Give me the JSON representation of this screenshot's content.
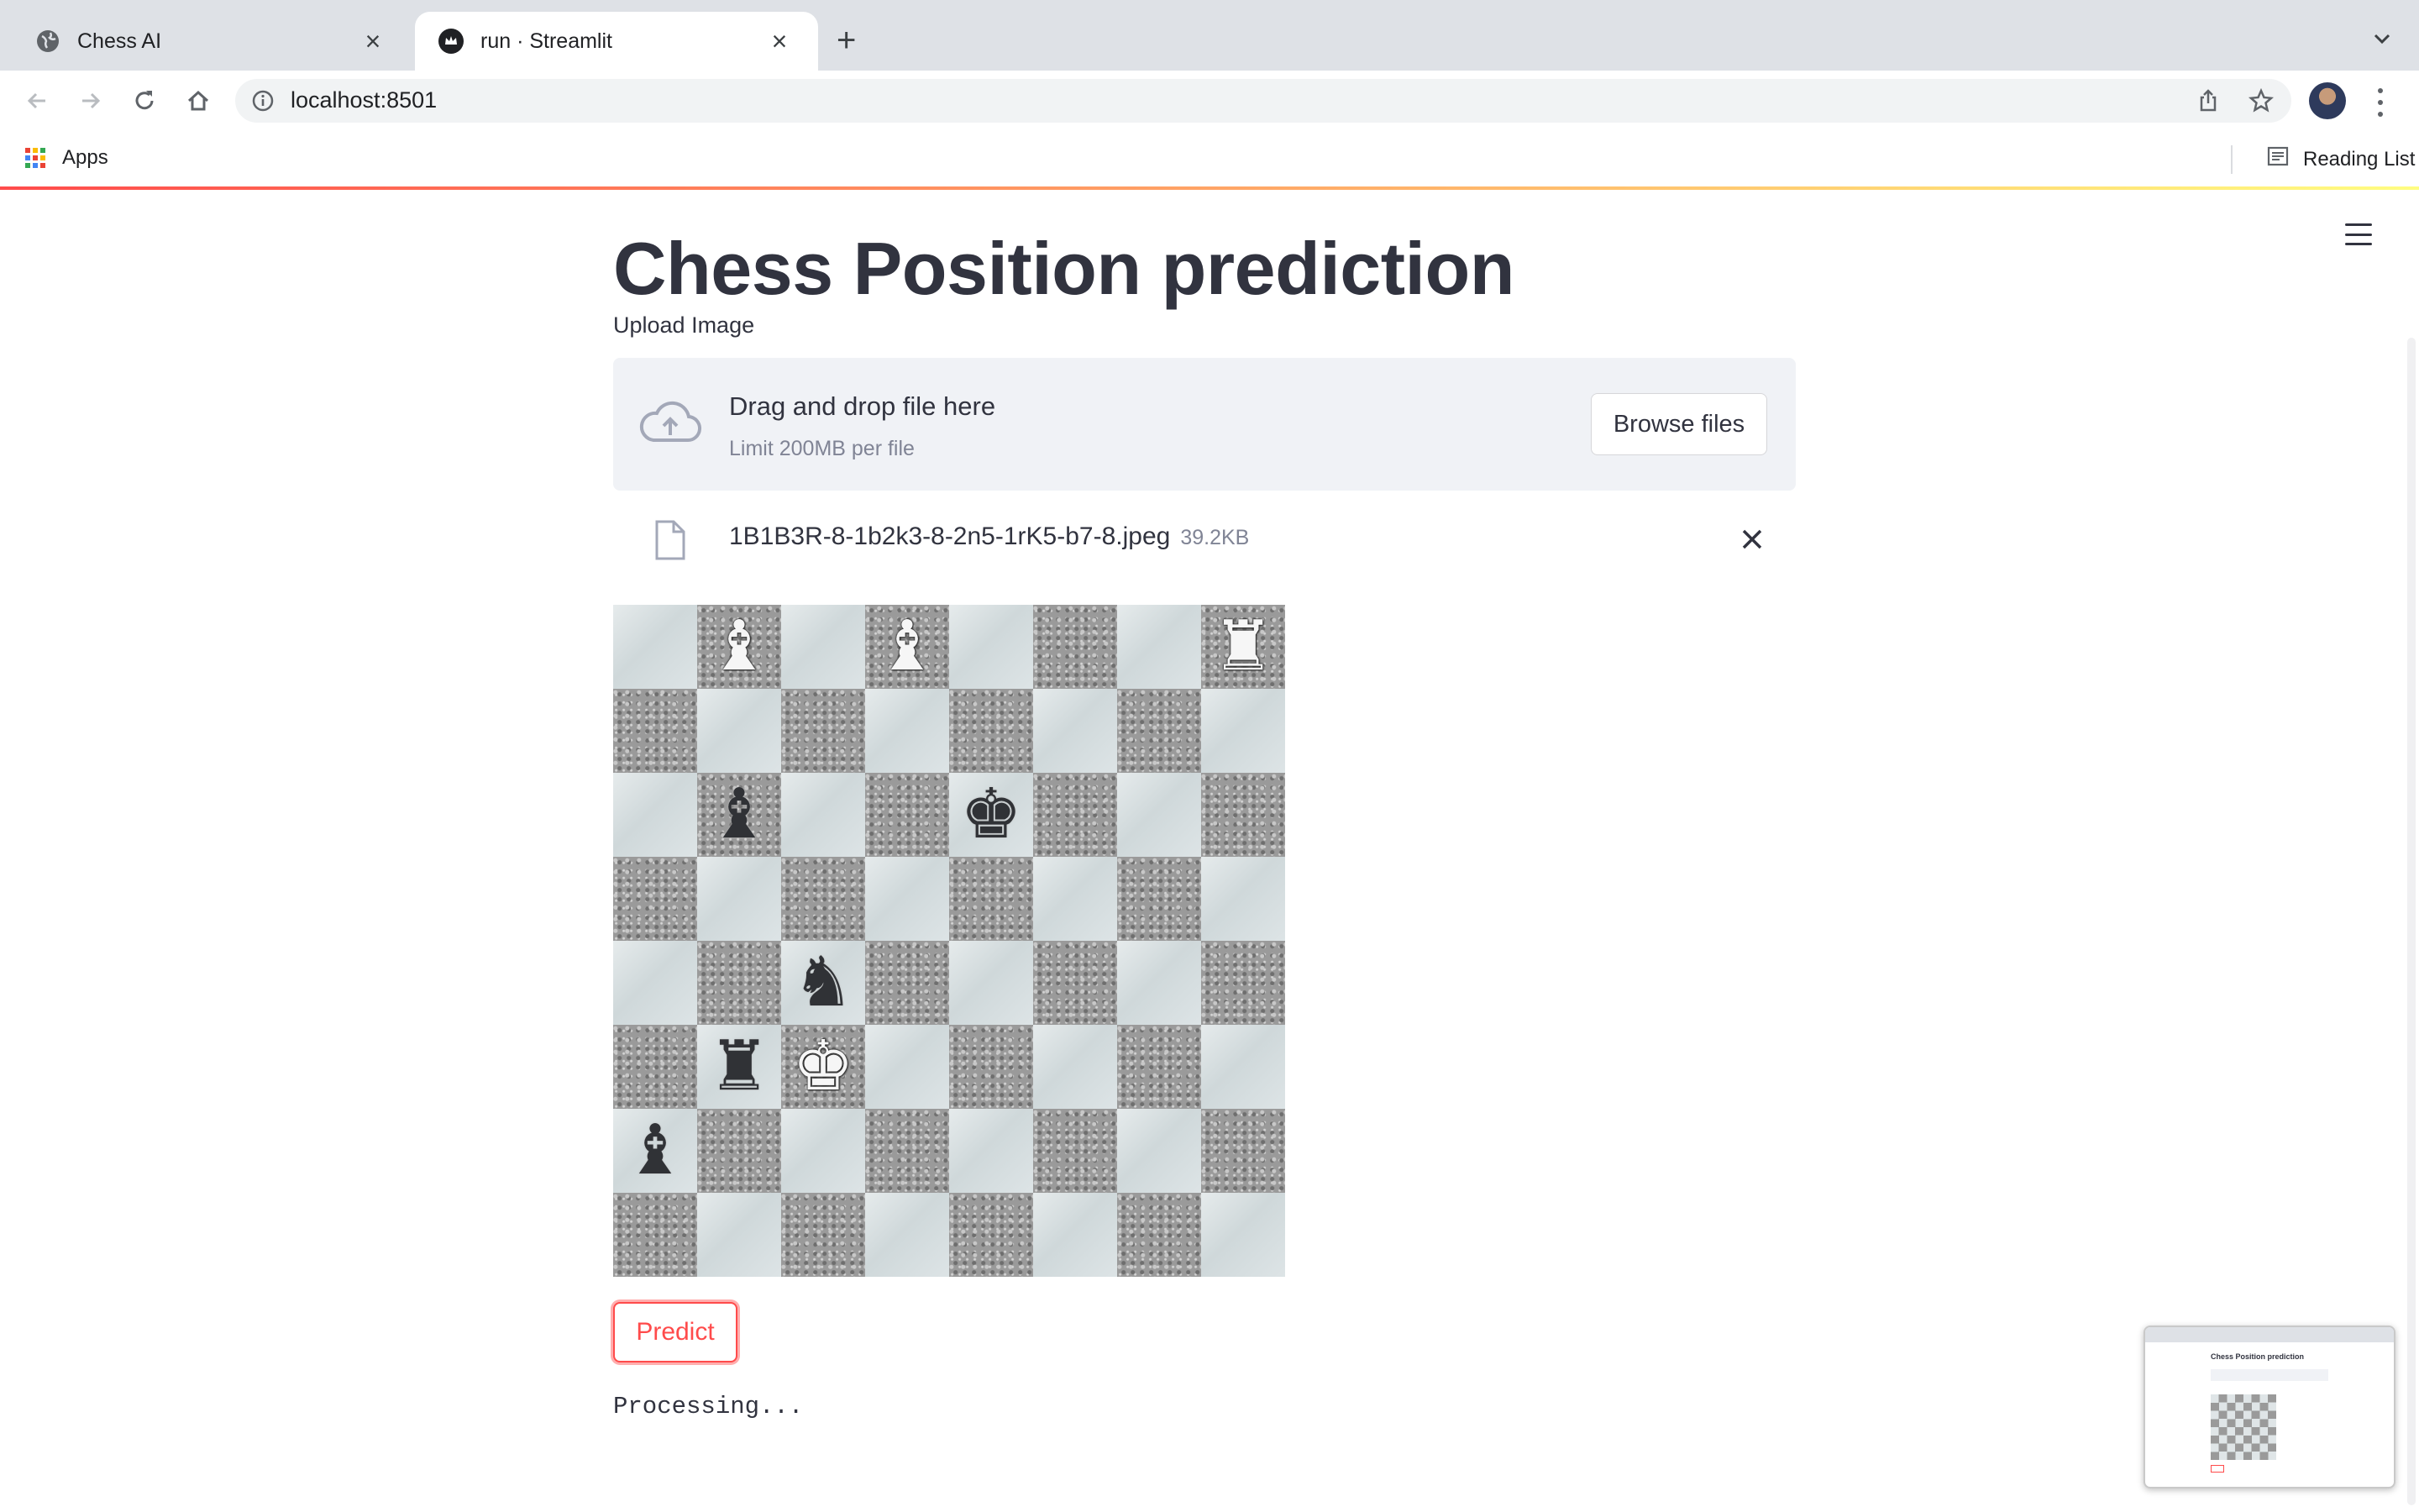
{
  "browser": {
    "tabs": [
      {
        "title": "Chess AI",
        "active": false,
        "favicon": "globe-icon"
      },
      {
        "title": "run · Streamlit",
        "active": true,
        "favicon": "streamlit-crown-icon"
      }
    ],
    "url": "localhost:8501",
    "bookmarks": {
      "apps_label": "Apps",
      "reading_list_label": "Reading List"
    }
  },
  "app": {
    "title": "Chess Position prediction",
    "uploader": {
      "label": "Upload Image",
      "drag_text": "Drag and drop file here",
      "limit_text": "Limit 200MB per file",
      "browse_label": "Browse files"
    },
    "file": {
      "name": "1B1B3R-8-1b2k3-8-2n5-1rK5-b7-8.jpeg",
      "size": "39.2KB"
    },
    "board": {
      "fen": "1B1B3R/8/1b2k3/8/2n5/1rK5/b7/8",
      "ranks": [
        [
          "",
          "B",
          "",
          "B",
          "",
          "",
          "",
          "R"
        ],
        [
          "",
          "",
          "",
          "",
          "",
          "",
          "",
          ""
        ],
        [
          "",
          "b",
          "",
          "",
          "k",
          "",
          "",
          ""
        ],
        [
          "",
          "",
          "",
          "",
          "",
          "",
          "",
          ""
        ],
        [
          "",
          "",
          "n",
          "",
          "",
          "",
          "",
          ""
        ],
        [
          "",
          "r",
          "K",
          "",
          "",
          "",
          "",
          ""
        ],
        [
          "b",
          "",
          "",
          "",
          "",
          "",
          "",
          ""
        ],
        [
          "",
          "",
          "",
          "",
          "",
          "",
          "",
          ""
        ]
      ]
    },
    "predict_label": "Predict",
    "status_text": "Processing...",
    "colors": {
      "primary": "#ff4b4b",
      "text": "#31333f",
      "secondary_bg": "#f0f2f6"
    }
  },
  "thumbnail": {
    "title": "Chess Position prediction"
  }
}
